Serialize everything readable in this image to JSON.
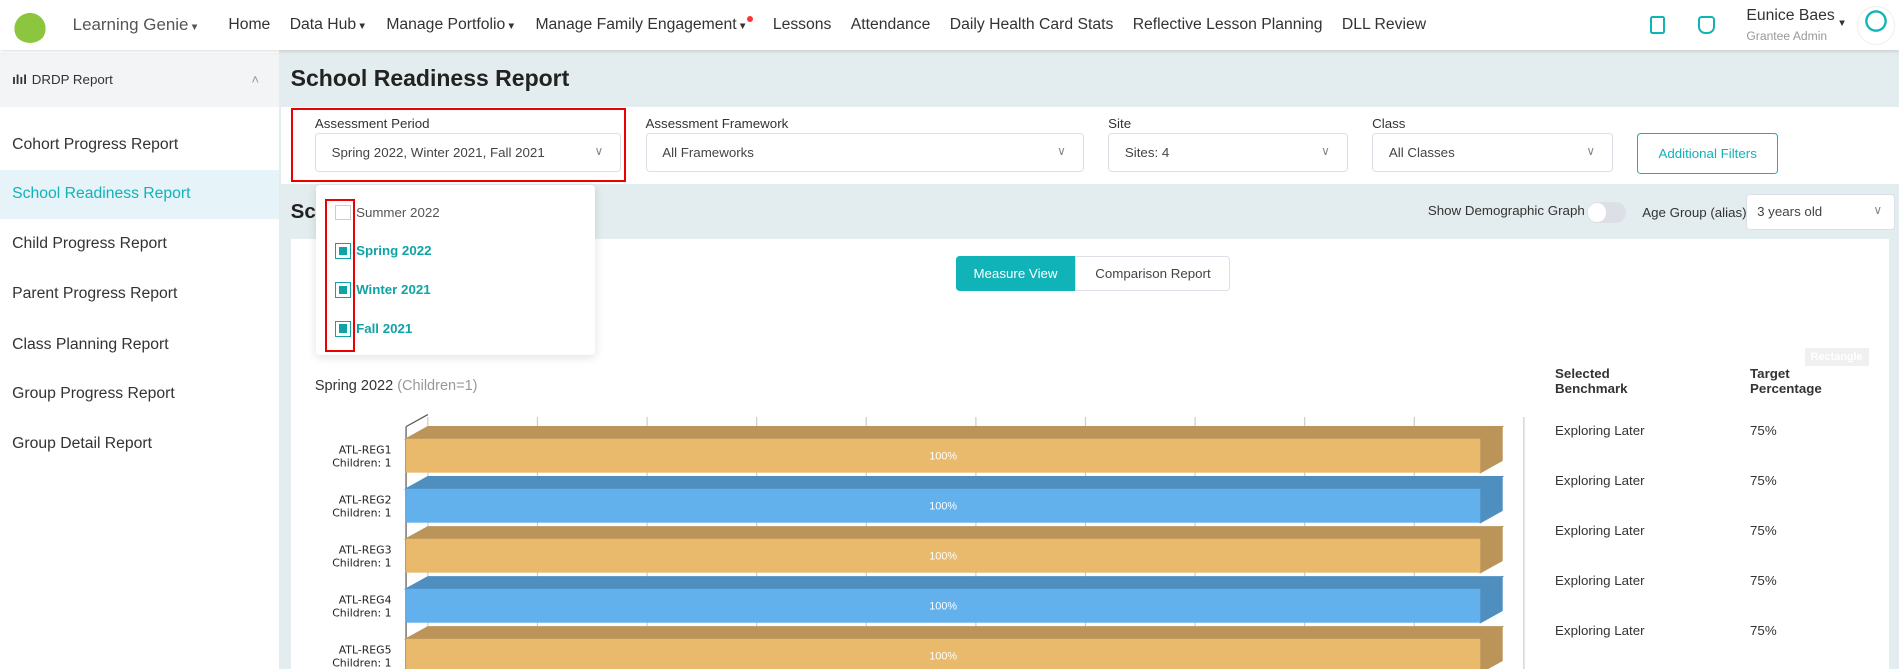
{
  "header": {
    "app_name": "Learning Genie",
    "nav": [
      "Home",
      "Data Hub",
      "Manage Portfolio",
      "Manage Family Engagement",
      "Lessons",
      "Attendance",
      "Daily Health Card Stats",
      "Reflective Lesson Planning",
      "DLL Review"
    ],
    "user_name": "Eunice Baes",
    "user_role": "Grantee Admin",
    "accent": "#10b3b7"
  },
  "sidebar": {
    "section": "DRDP Report",
    "items": [
      {
        "label": "Cohort Progress Report"
      },
      {
        "label": "School Readiness Report",
        "selected": true
      },
      {
        "label": "Child Progress Report"
      },
      {
        "label": "Parent Progress Report"
      },
      {
        "label": "Class Planning Report"
      },
      {
        "label": "Group Progress Report"
      },
      {
        "label": "Group Detail Report"
      }
    ]
  },
  "page": {
    "title": "School Readiness Report",
    "section_title_partial": "Sc"
  },
  "filters": {
    "period_label": "Assessment Period",
    "period_value": "Spring 2022, Winter 2021, Fall 2021",
    "framework_label": "Assessment Framework",
    "framework_value": "All Frameworks",
    "site_label": "Site",
    "site_value": "Sites: 4",
    "class_label": "Class",
    "class_value": "All Classes",
    "additional": "Additional Filters"
  },
  "period_options": [
    {
      "label": "Summer 2022",
      "checked": false
    },
    {
      "label": "Spring 2022",
      "checked": true
    },
    {
      "label": "Winter 2021",
      "checked": true
    },
    {
      "label": "Fall 2021",
      "checked": true
    }
  ],
  "controls": {
    "demographic_label": "Show Demographic Graph",
    "demographic_on": false,
    "age_label": "Age Group (alias)",
    "age_value": "3 years old",
    "measure_view": "Measure View",
    "comparison": "Comparison Report",
    "rectangle": "Rectangle"
  },
  "chart_data": {
    "type": "bar",
    "orientation": "horizontal",
    "3d": true,
    "title": "Spring 2022",
    "subtitle": "(Children=1)",
    "categories": [
      "ATL-REG1",
      "ATL-REG2",
      "ATL-REG3",
      "ATL-REG4",
      "ATL-REG5"
    ],
    "category_sublabels": [
      "Children: 1",
      "Children: 1",
      "Children: 1",
      "Children: 1",
      "Children: 1"
    ],
    "values": [
      100,
      100,
      100,
      100,
      100
    ],
    "data_labels": [
      "100%",
      "100%",
      "100%",
      "100%",
      "100%"
    ],
    "colors": [
      "#e9b96c",
      "#62b1ec",
      "#e9b96c",
      "#62b1ec",
      "#e9b96c"
    ],
    "xlim": [
      0,
      100
    ],
    "grid": true
  },
  "benchmark_table": {
    "headers": [
      "Selected Benchmark",
      "Target Percentage"
    ],
    "rows": [
      [
        "Exploring Later",
        "75%"
      ],
      [
        "Exploring Later",
        "75%"
      ],
      [
        "Exploring Later",
        "75%"
      ],
      [
        "Exploring Later",
        "75%"
      ],
      [
        "Exploring Later",
        "75%"
      ]
    ]
  }
}
